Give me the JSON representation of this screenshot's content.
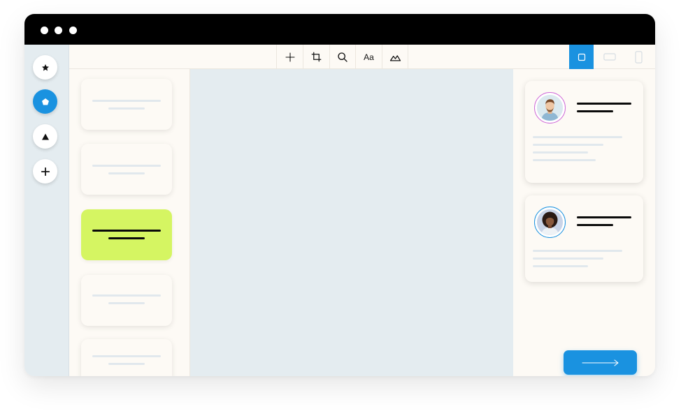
{
  "window": {
    "controls": [
      "dot",
      "dot",
      "dot"
    ]
  },
  "rail": {
    "items": [
      {
        "icon": "star-icon",
        "active": false
      },
      {
        "icon": "pentagon-icon",
        "active": true
      },
      {
        "icon": "triangle-icon",
        "active": false
      },
      {
        "icon": "plus-icon",
        "active": false
      }
    ]
  },
  "toolbar": {
    "tools": [
      {
        "icon": "move-crosshair-icon"
      },
      {
        "icon": "crop-icon"
      },
      {
        "icon": "search-icon"
      },
      {
        "icon": "text-icon",
        "label": "Aa"
      },
      {
        "icon": "landscape-icon"
      }
    ],
    "views": [
      {
        "icon": "square-view-icon",
        "active": true
      },
      {
        "icon": "landscape-view-icon",
        "active": false
      },
      {
        "icon": "portrait-view-icon",
        "active": false
      }
    ]
  },
  "cards": {
    "count": 5,
    "selected_index": 2
  },
  "profiles": [
    {
      "avatar": "man-avatar",
      "ring_color": "#cf6ad8"
    },
    {
      "avatar": "woman-avatar",
      "ring_color": "#1a92e0"
    }
  ],
  "next_button": {
    "icon": "arrow-right-icon"
  },
  "colors": {
    "accent": "#1a92e0",
    "highlight": "#d5f562",
    "canvas": "#e4ecf0",
    "panel": "#fdfaf5",
    "titlebar": "#000000"
  }
}
